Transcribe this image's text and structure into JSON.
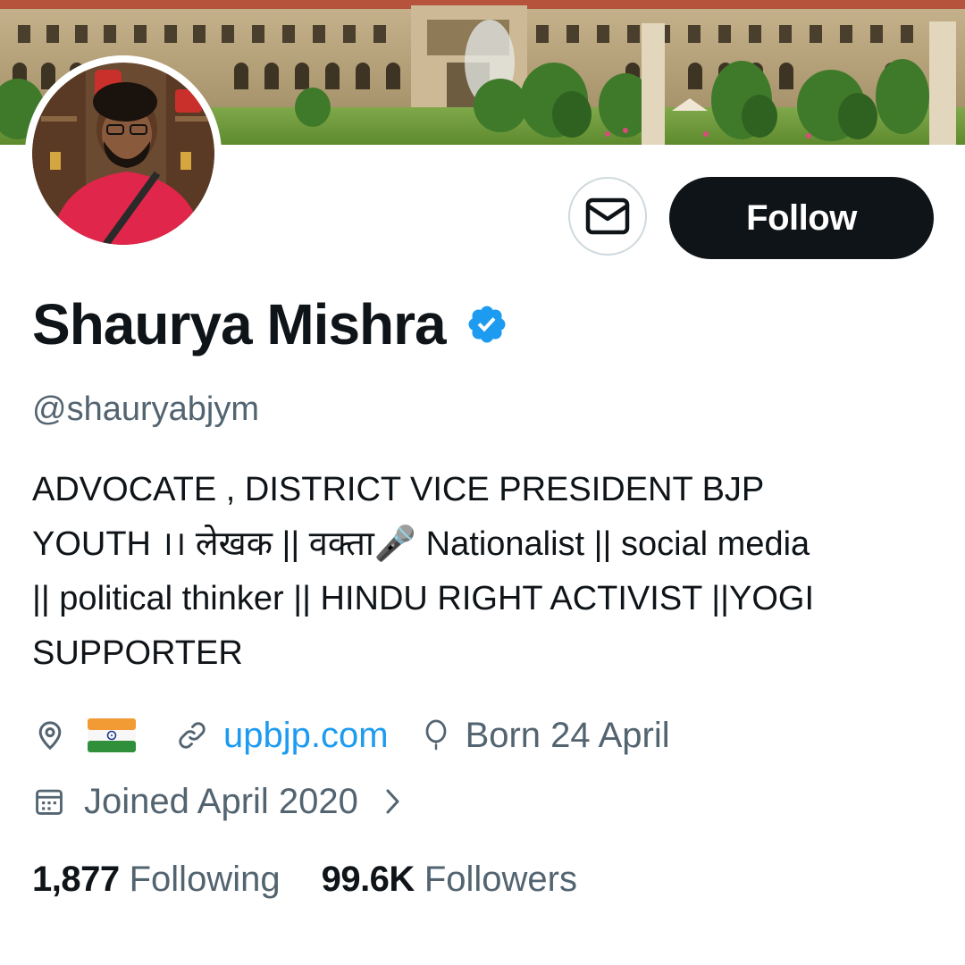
{
  "profile": {
    "name": "Shaurya Mishra",
    "handle": "@shauryabjym",
    "verified": true,
    "bio_lines": [
      "ADVOCATE , DISTRICT VICE PRESIDENT BJP",
      "YOUTH ।। लेखक || वक्ता🎤 Nationalist || social media",
      "|| political thinker || HINDU RIGHT ACTIVIST ||YOGI",
      "SUPPORTER"
    ]
  },
  "actions": {
    "follow_label": "Follow",
    "message_icon": "envelope-icon"
  },
  "meta": {
    "location_icon": "location-pin-icon",
    "location_flag": "india-flag",
    "link_icon": "link-icon",
    "link_text": "upbjp.com",
    "birthday_icon": "balloon-icon",
    "birthday_text": "Born 24 April",
    "joined_icon": "calendar-icon",
    "joined_text": "Joined April 2020",
    "joined_chevron": "chevron-right-icon"
  },
  "stats": {
    "following_count": "1,877",
    "following_label": "Following",
    "followers_count": "99.6K",
    "followers_label": "Followers"
  },
  "colors": {
    "text_primary": "#0f1419",
    "text_secondary": "#536471",
    "link": "#1d9bf0",
    "verified": "#1d9bf0",
    "follow_button_bg": "#0f1419",
    "follow_button_text": "#ffffff",
    "border": "#cfd9de"
  }
}
